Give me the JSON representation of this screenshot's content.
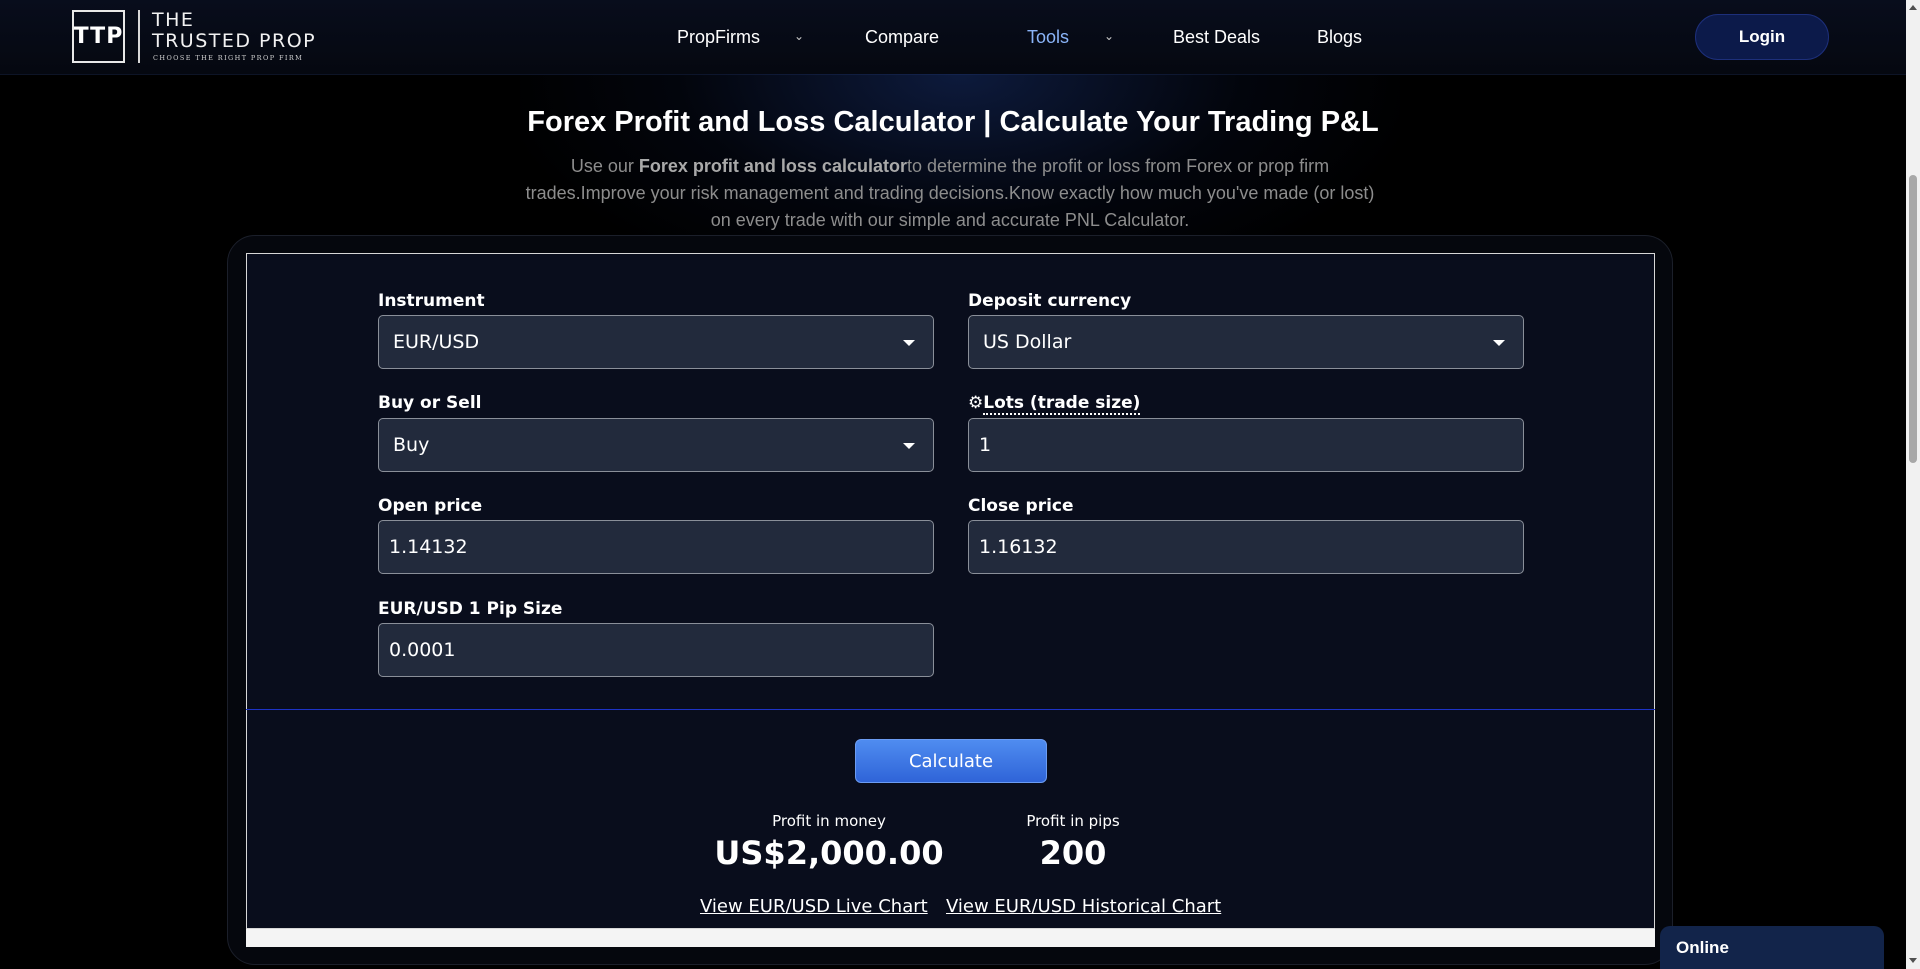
{
  "header": {
    "logo_mark": "TTP",
    "logo_title_line1": "THE",
    "logo_title_line2": "TRUSTED PROP",
    "logo_tagline": "CHOOSE THE RIGHT PROP FIRM",
    "nav": {
      "propfirms": "PropFirms",
      "compare": "Compare",
      "tools": "Tools",
      "best_deals": "Best Deals",
      "blogs": "Blogs"
    },
    "login_label": "Login",
    "colors": {
      "tools_active": "#8ab4f8",
      "login_bg": "#0c1a4a"
    }
  },
  "hero": {
    "title": "Forex Profit and Loss Calculator | Calculate Your Trading P&L",
    "desc_prefix": "Use our ",
    "desc_bold": "Forex profit and loss calculator",
    "desc_rest": "to determine the profit or loss from Forex or prop firm trades.Improve your risk management and trading decisions.Know exactly how much you've made (or lost) on every trade with our simple and accurate PNL Calculator."
  },
  "form": {
    "instrument": {
      "label": "Instrument",
      "value": "EUR/USD"
    },
    "deposit_currency": {
      "label": "Deposit currency",
      "value": "US Dollar"
    },
    "buy_sell": {
      "label": "Buy or Sell",
      "value": "Buy"
    },
    "lots": {
      "label": "Lots (trade size)",
      "value": "1"
    },
    "open_price": {
      "label": "Open price",
      "value": "1.14132"
    },
    "close_price": {
      "label": "Close price",
      "value": "1.16132"
    },
    "pip_size": {
      "label": "EUR/USD 1 Pip Size",
      "value": "0.0001"
    }
  },
  "calculate_label": "Calculate",
  "results": {
    "money_label": "Profit in money",
    "money_value": "US$2,000.00",
    "pips_label": "Profit in pips",
    "pips_value": "200"
  },
  "links": {
    "live_chart": "View EUR/USD Live Chart",
    "historical_chart": "View EUR/USD Historical Chart"
  },
  "chat": {
    "status": "Online"
  }
}
